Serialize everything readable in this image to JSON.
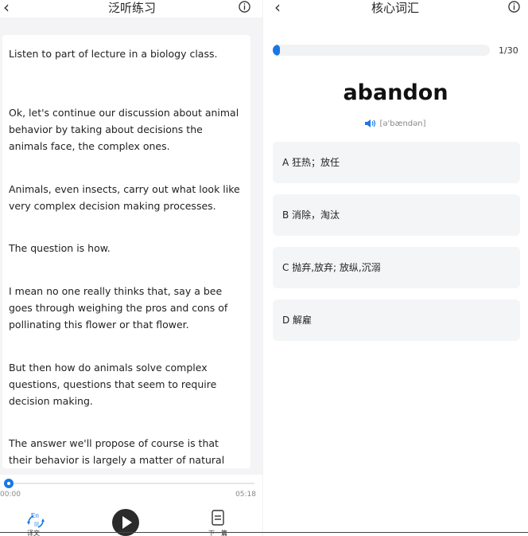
{
  "left": {
    "header": {
      "title": "泛听练习"
    },
    "transcript": [
      "Listen to part of lecture in a biology class.",
      "Ok, let's continue our discussion about animal behavior by taking about decisions the animals face, the complex ones.",
      "Animals, even insects, carry out what look like very complex decision making processes.",
      "The question is how.",
      "I mean no one really thinks that, say a bee goes through weighing the pros and cons of pollinating this flower or that flower.",
      "But then how do animals solve complex questions, questions that seem to require decision making.",
      "The answer we'll propose of course is that their behavior is largely a matter of natural selection."
    ],
    "player": {
      "current_time": "00:00",
      "total_time": "05:18",
      "progress": 0.0,
      "translate_label": "译文",
      "next_label": "下一篇"
    }
  },
  "right": {
    "header": {
      "title": "核心词汇"
    },
    "progress": {
      "current": 1,
      "total": 30,
      "label": "1/30"
    },
    "word": "abandon",
    "phonetic": "[ə'bændən]",
    "options": [
      {
        "label": "A 狂热；放任"
      },
      {
        "label": "B 消除，淘汰"
      },
      {
        "label": "C 抛弃,放弃; 放纵,沉溺"
      },
      {
        "label": "D 解雇"
      }
    ]
  },
  "colors": {
    "accent": "#1a78e5",
    "panel_bg": "#f4f4f6",
    "option_bg": "#f4f5f7"
  }
}
